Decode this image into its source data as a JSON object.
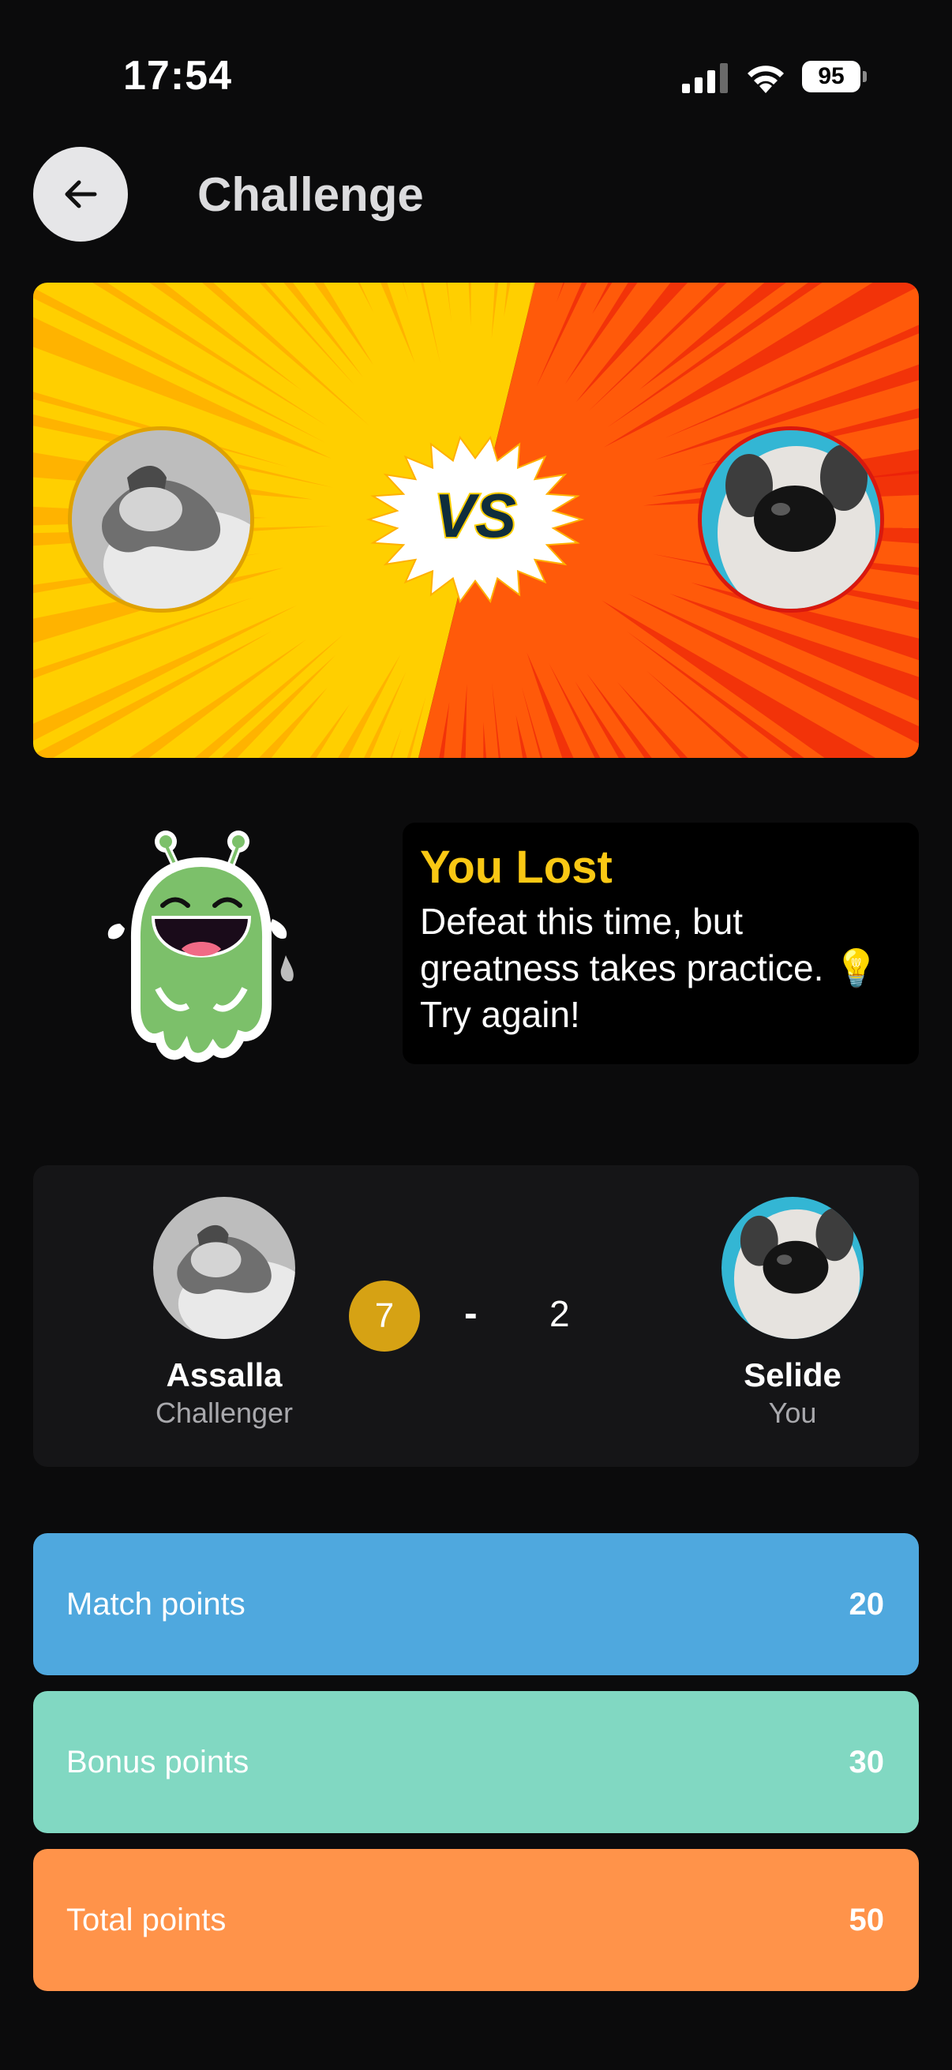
{
  "status": {
    "time": "17:54",
    "battery": "95"
  },
  "header": {
    "title": "Challenge"
  },
  "banner": {
    "vs_label": "VS"
  },
  "result": {
    "title": "You Lost",
    "message": "Defeat this time, but greatness takes practice. 💡 Try again!"
  },
  "match": {
    "challenger": {
      "name": "Assalla",
      "role": "Challenger",
      "score": "7"
    },
    "separator": "-",
    "you": {
      "name": "Selide",
      "role": "You",
      "score": "2"
    }
  },
  "points": [
    {
      "label": "Match points",
      "value": "20",
      "color": "#4fa8de"
    },
    {
      "label": "Bonus points",
      "value": "30",
      "color": "#81d8c2"
    },
    {
      "label": "Total points",
      "value": "50",
      "color": "#ff934a"
    }
  ],
  "colors": {
    "banner_left": "#ffd000",
    "banner_right": "#ff5a0a",
    "accent_yellow": "#f9c814",
    "score_badge": "#d6a214"
  },
  "icons": {
    "back": "arrow-left-icon",
    "mascot": "crying-alien-mascot"
  }
}
